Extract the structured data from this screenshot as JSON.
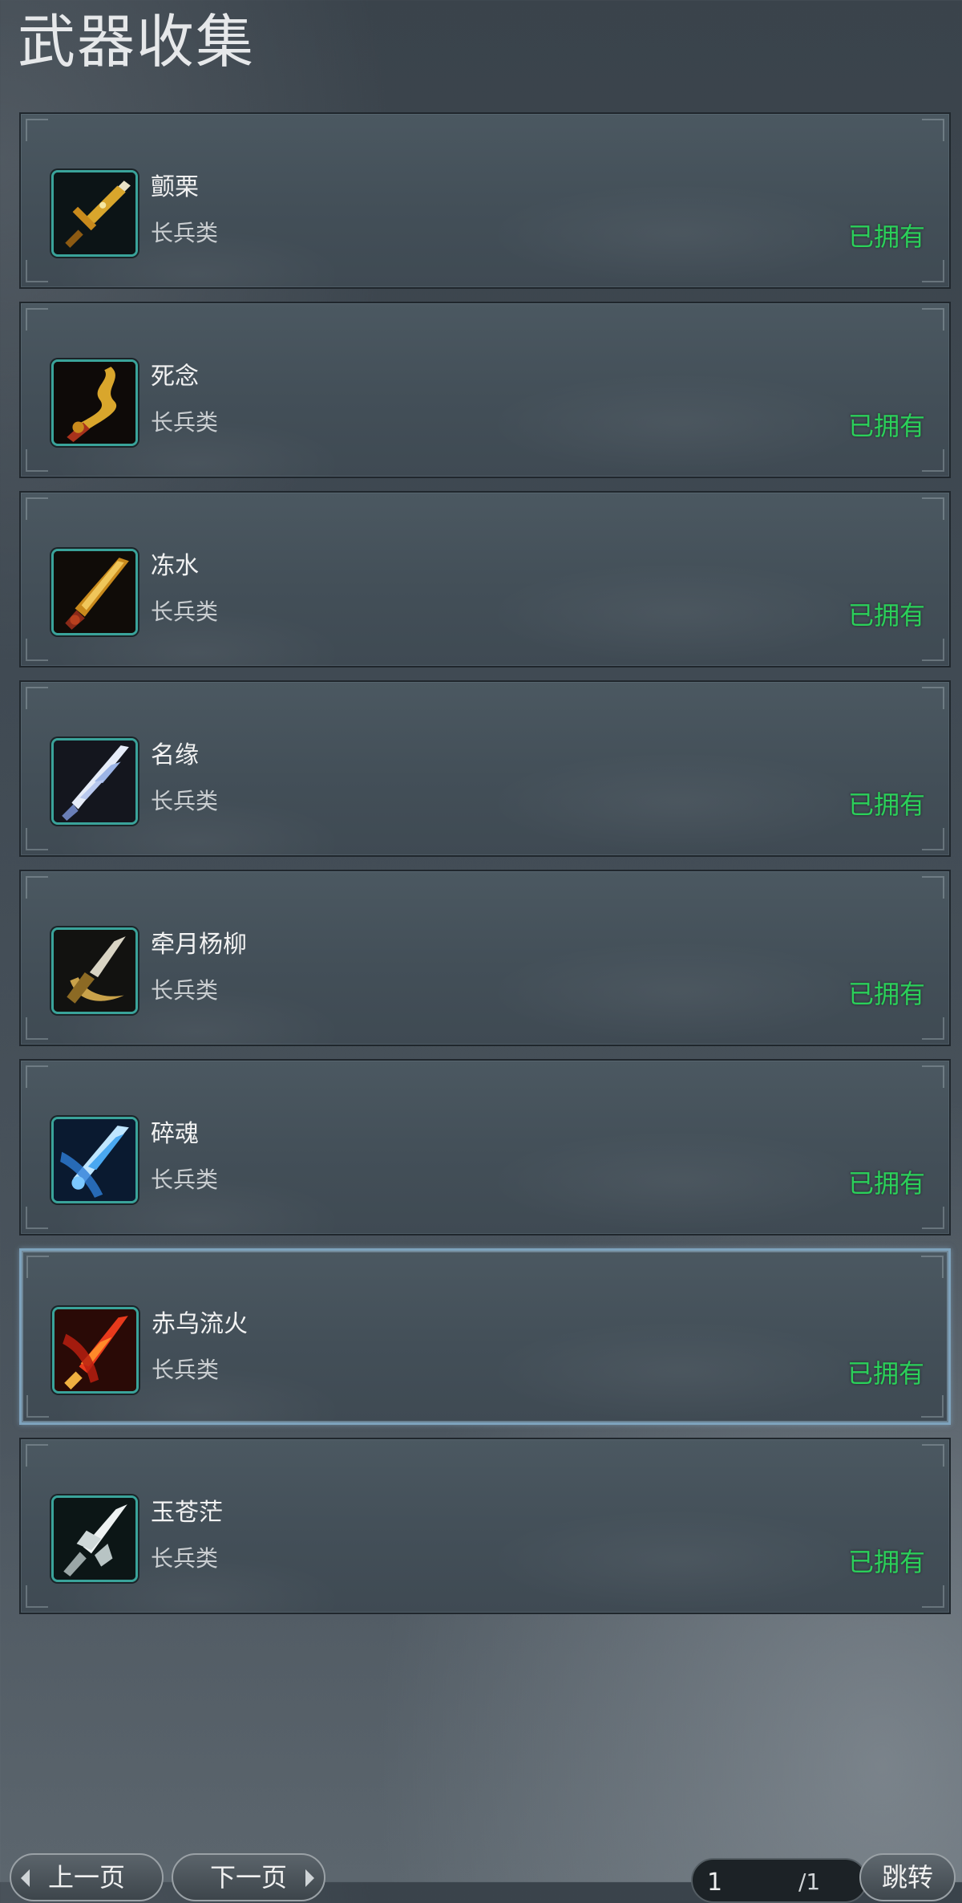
{
  "header": {
    "title": "武器收集"
  },
  "weapons": [
    {
      "name": "颤栗",
      "type": "长兵类",
      "status": "已拥有",
      "icon": "golden-sword-icon",
      "selected": false
    },
    {
      "name": "死念",
      "type": "长兵类",
      "status": "已拥有",
      "icon": "golden-curved-blade-icon",
      "selected": false
    },
    {
      "name": "冻水",
      "type": "长兵类",
      "status": "已拥有",
      "icon": "golden-blade-icon",
      "selected": false
    },
    {
      "name": "名缘",
      "type": "长兵类",
      "status": "已拥有",
      "icon": "white-crystal-blade-icon",
      "selected": false
    },
    {
      "name": "牵月杨柳",
      "type": "长兵类",
      "status": "已拥有",
      "icon": "crescent-spear-icon",
      "selected": false
    },
    {
      "name": "碎魂",
      "type": "长兵类",
      "status": "已拥有",
      "icon": "blue-ice-blade-icon",
      "selected": false
    },
    {
      "name": "赤乌流火",
      "type": "长兵类",
      "status": "已拥有",
      "icon": "red-fire-spear-icon",
      "selected": true
    },
    {
      "name": "玉苍茫",
      "type": "长兵类",
      "status": "已拥有",
      "icon": "silver-halberd-icon",
      "selected": false
    }
  ],
  "pagination": {
    "prev_label": "上一页",
    "next_label": "下一页",
    "current_page": "1",
    "total_pages": "/1",
    "jump_label": "跳转"
  },
  "colors": {
    "owned_status": "#2bd05a",
    "icon_frame": "#3aa39a",
    "selected_border": "#7ea3bd"
  }
}
